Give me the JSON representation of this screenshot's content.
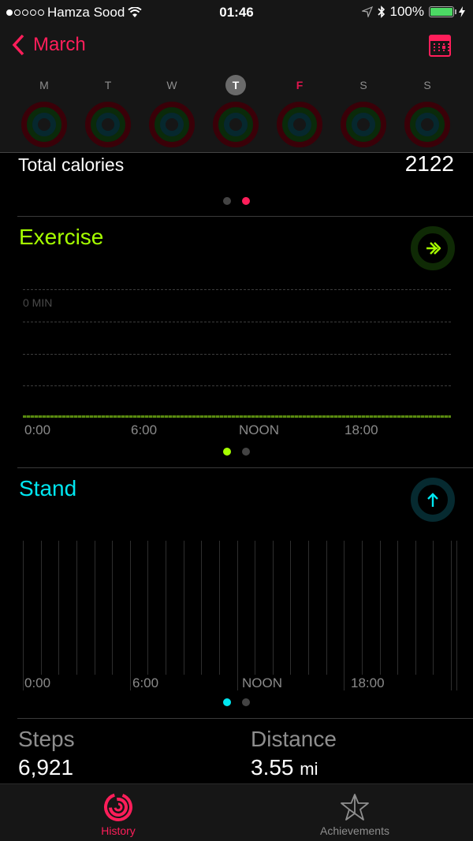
{
  "status_bar": {
    "signal_dots": [
      true,
      false,
      false,
      false,
      false
    ],
    "carrier": "Hamza Sood",
    "wifi_icon": "wifi-icon",
    "time": "01:46",
    "location_icon": "location-arrow-icon",
    "bluetooth_icon": "bluetooth-icon",
    "battery_percent": "100%",
    "battery_level": 1.0,
    "charging_icon": "bolt-icon"
  },
  "nav": {
    "back_label": "March",
    "calendar_icon": "calendar-icon"
  },
  "week": {
    "days": [
      {
        "label": "M",
        "state": "normal"
      },
      {
        "label": "T",
        "state": "normal"
      },
      {
        "label": "W",
        "state": "normal"
      },
      {
        "label": "T",
        "state": "today"
      },
      {
        "label": "F",
        "state": "selected"
      },
      {
        "label": "S",
        "state": "normal"
      },
      {
        "label": "S",
        "state": "normal"
      }
    ]
  },
  "move": {
    "label": "Total calories",
    "value": "2122",
    "page_index": 1,
    "page_count": 2
  },
  "exercise": {
    "title": "Exercise",
    "color": "#a6ff00",
    "icon": "double-chevron-right-icon",
    "y_label": "0 MIN",
    "x_labels": [
      "0:00",
      "6:00",
      "NOON",
      "18:00"
    ],
    "page_index": 0,
    "page_count": 2
  },
  "stand": {
    "title": "Stand",
    "color": "#00e6f0",
    "icon": "arrow-up-icon",
    "x_labels": [
      "0:00",
      "6:00",
      "NOON",
      "18:00"
    ],
    "hours": 24,
    "page_index": 0,
    "page_count": 2
  },
  "stats": {
    "steps_label": "Steps",
    "steps_value": "6,921",
    "distance_label": "Distance",
    "distance_value": "3.55",
    "distance_unit": "mi"
  },
  "tabs": [
    {
      "label": "History",
      "icon": "activity-rings-icon",
      "active": true
    },
    {
      "label": "Achievements",
      "icon": "star-icon",
      "active": false
    }
  ],
  "colors": {
    "accent": "#ff1e5a",
    "move": "#ff1e5a",
    "exercise": "#a6ff00",
    "stand": "#00e6f0"
  }
}
